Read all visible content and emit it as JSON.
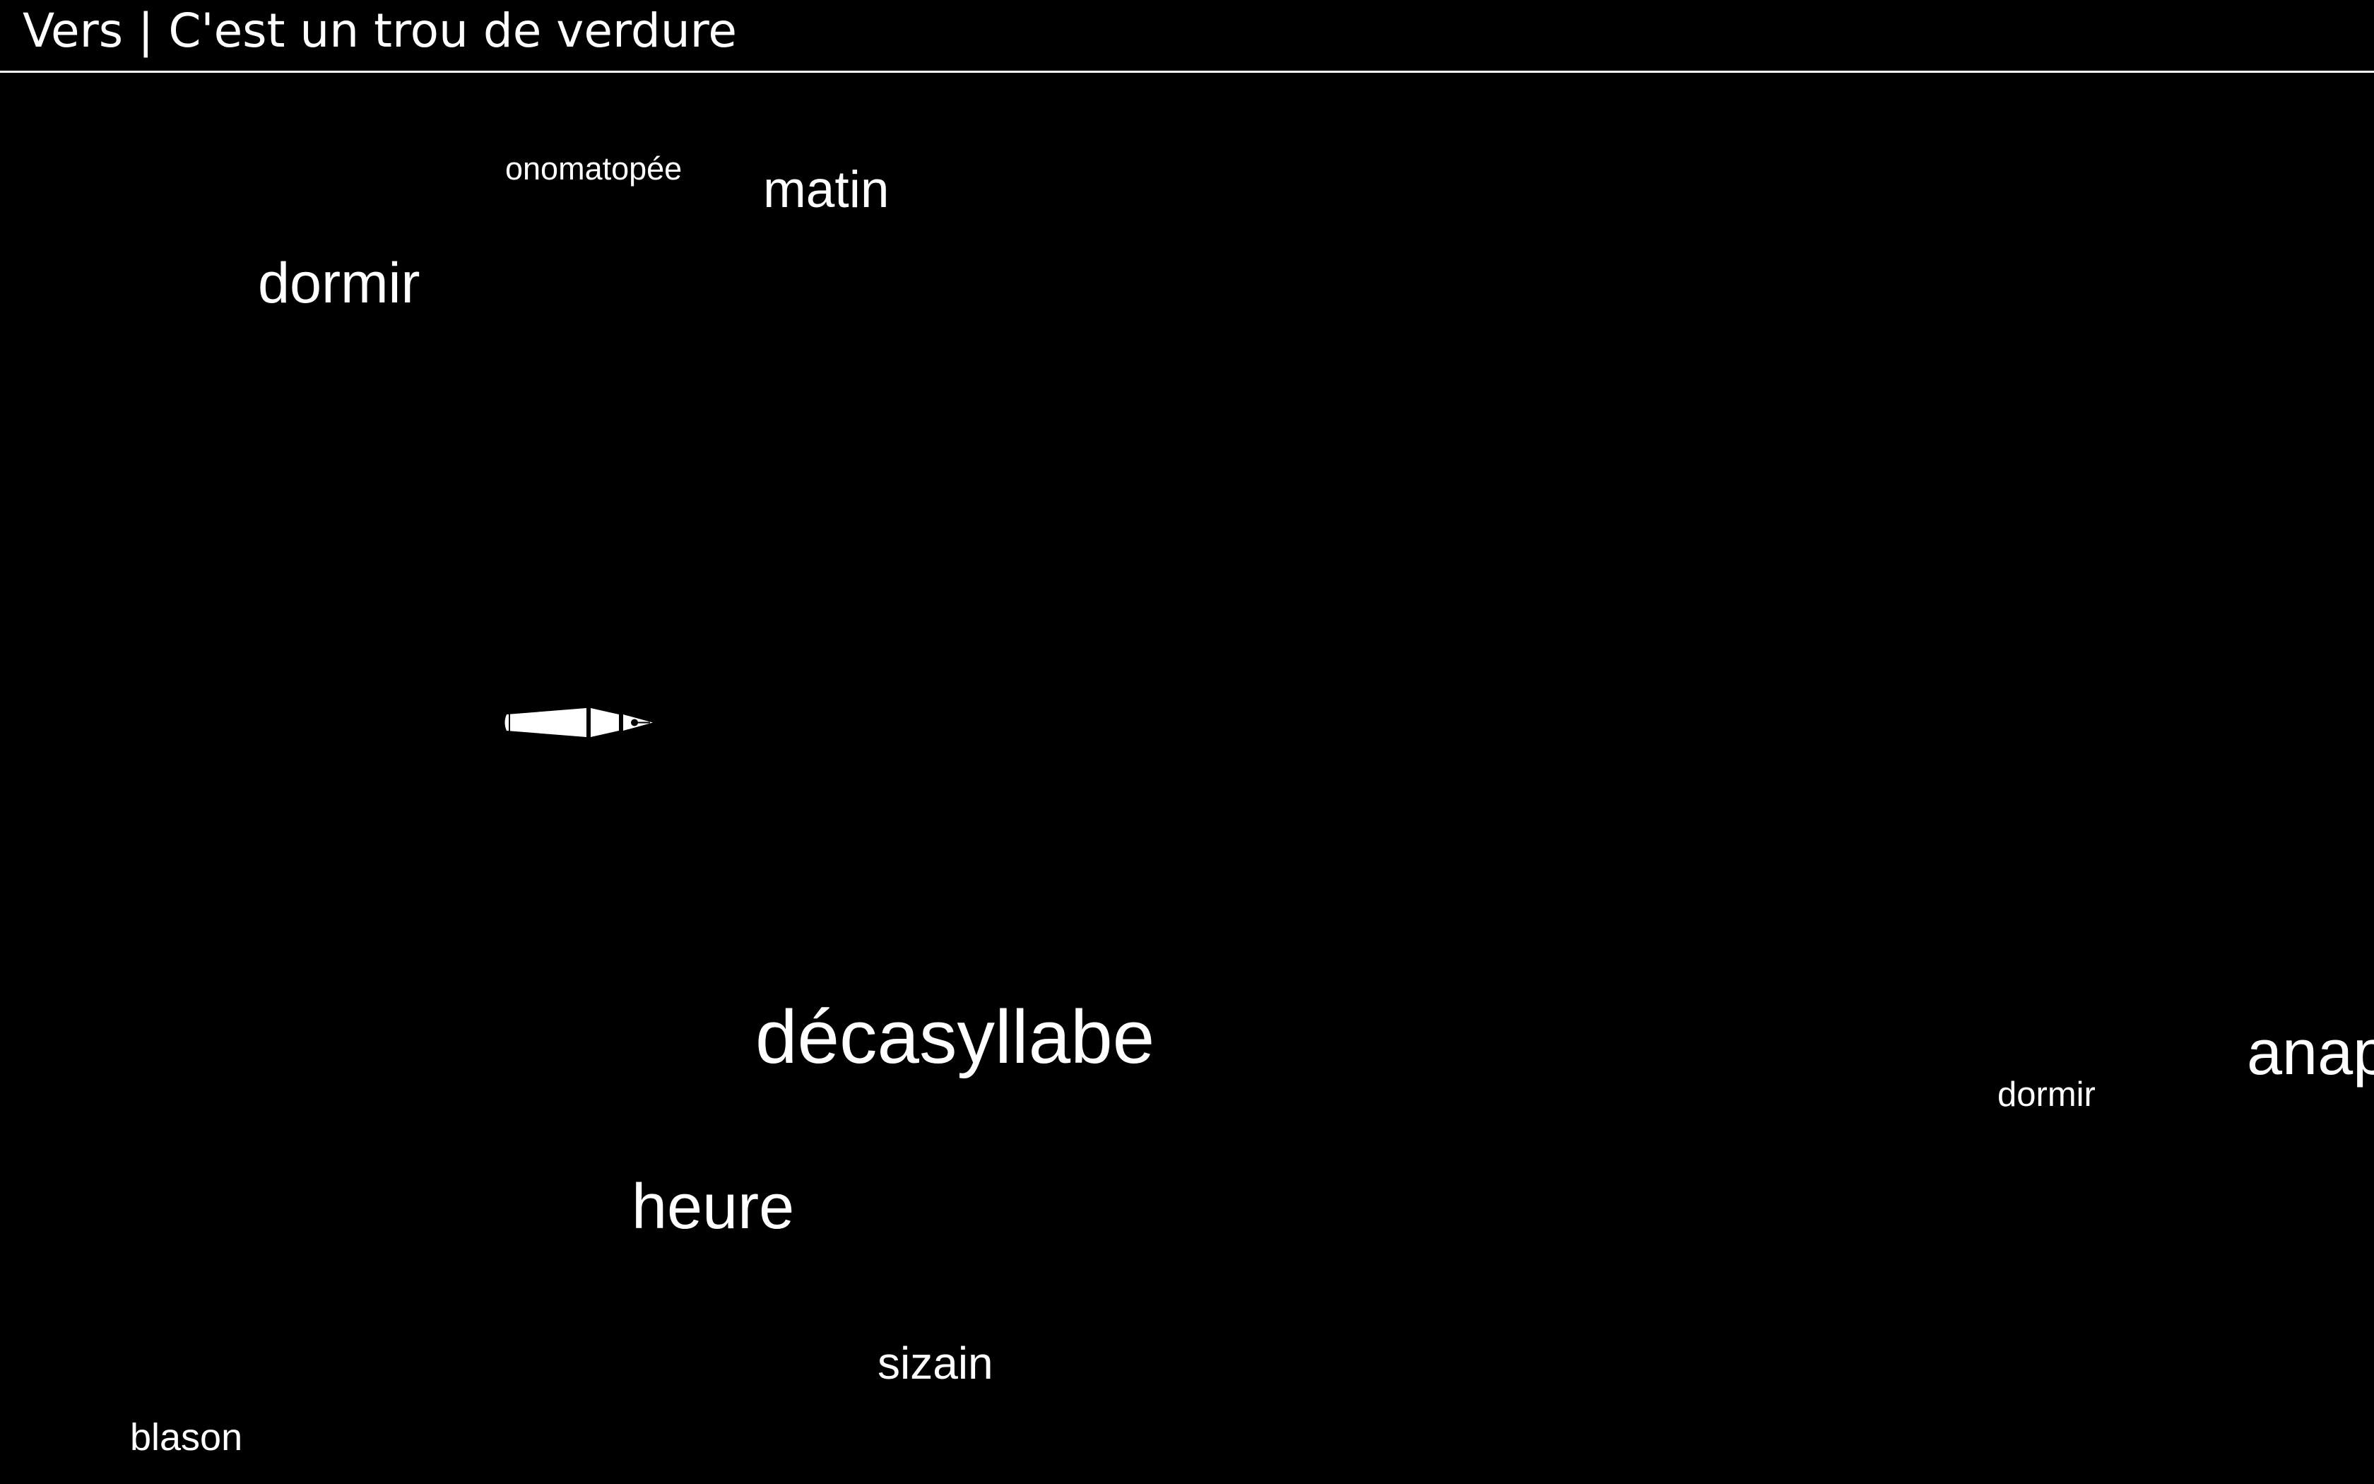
{
  "header": {
    "title": "Vers | C'est un trou de verdure"
  },
  "words": {
    "w1": "onomatopée",
    "w2": "matin",
    "w3": "dormir",
    "w4": "décasyllabe",
    "w5": "dormir",
    "w6": "anap",
    "w7": "heure",
    "w8": "sizain",
    "w9": "blason"
  },
  "cursor": {
    "icon": "fountain-pen-icon"
  },
  "colors": {
    "background": "#000000",
    "foreground": "#ffffff"
  }
}
